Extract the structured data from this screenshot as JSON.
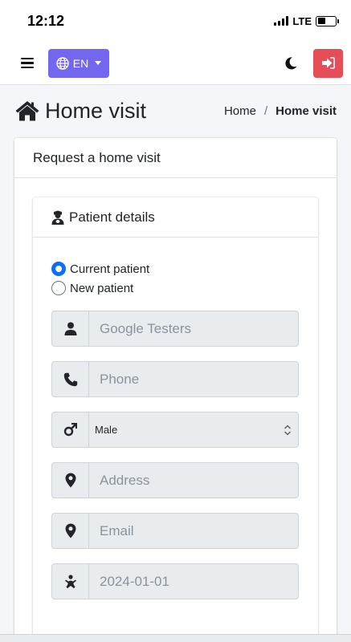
{
  "status_bar": {
    "time": "12:12",
    "network": "LTE"
  },
  "navbar": {
    "language": "EN"
  },
  "page": {
    "title": "Home visit"
  },
  "breadcrumb": {
    "home": "Home",
    "separator": "/",
    "current": "Home visit"
  },
  "card": {
    "title": "Request a home visit"
  },
  "patient_details": {
    "title": "Patient details",
    "radio_options": [
      {
        "label": "Current patient",
        "checked": true
      },
      {
        "label": "New patient",
        "checked": false
      }
    ],
    "fields": {
      "name_value": "Google Testers",
      "phone_placeholder": "Phone",
      "gender_selected": "Male",
      "address_placeholder": "Address",
      "email_placeholder": "Email",
      "dob_value": "2024-01-01"
    }
  },
  "colors": {
    "accent": "#7367f0",
    "logout": "#e54d58",
    "radio_checked": "#0d6efd"
  }
}
